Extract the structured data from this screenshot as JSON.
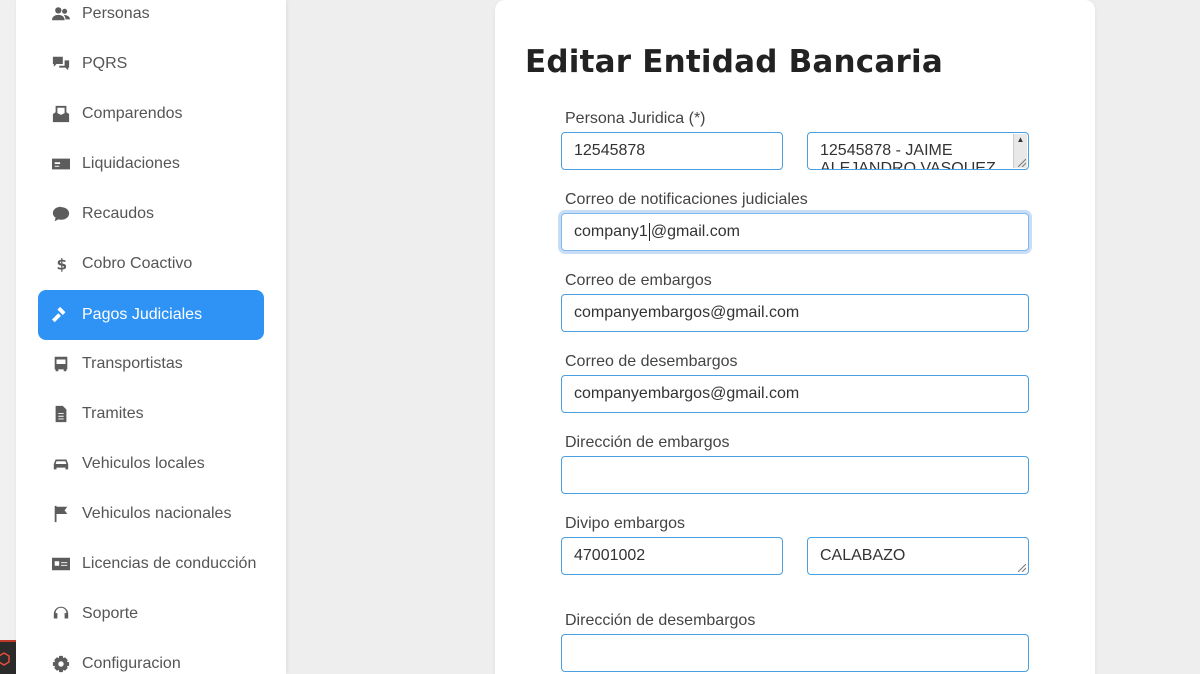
{
  "sidebar": {
    "items": [
      {
        "label": "Personas",
        "icon": "users-icon"
      },
      {
        "label": "PQRS",
        "icon": "chat-icon"
      },
      {
        "label": "Comparendos",
        "icon": "inbox-icon"
      },
      {
        "label": "Liquidaciones",
        "icon": "money-bill-icon"
      },
      {
        "label": "Recaudos",
        "icon": "comment-dollar-icon"
      },
      {
        "label": "Cobro Coactivo",
        "icon": "dollar-icon"
      },
      {
        "label": "Pagos Judiciales",
        "icon": "gavel-icon",
        "active": true
      },
      {
        "label": "Transportistas",
        "icon": "bus-icon"
      },
      {
        "label": "Tramites",
        "icon": "file-icon"
      },
      {
        "label": "Vehiculos locales",
        "icon": "car-icon"
      },
      {
        "label": "Vehiculos nacionales",
        "icon": "flag-icon"
      },
      {
        "label": "Licencias de conducción",
        "icon": "id-card-icon"
      },
      {
        "label": "Soporte",
        "icon": "headset-icon"
      },
      {
        "label": "Configuracion",
        "icon": "gear-icon"
      }
    ]
  },
  "form": {
    "title": "Editar Entidad Bancaria",
    "persona_juridica": {
      "label": "Persona Juridica (*)",
      "id_value": "12545878",
      "name_value_line1": "12545878 - JAIME",
      "name_value_line2": "ALEJANDRO VASQUEZ"
    },
    "correo_notificaciones": {
      "label": "Correo de notificaciones judiciales",
      "value_before_cursor": "company1",
      "value_after_cursor": "@gmail.com"
    },
    "correo_embargos": {
      "label": "Correo de embargos",
      "value": "companyembargos@gmail.com"
    },
    "correo_desembargos": {
      "label": "Correo de desembargos",
      "value": "companyembargos@gmail.com"
    },
    "direccion_embargos": {
      "label": "Dirección de embargos",
      "value": ""
    },
    "divipo_embargos": {
      "label": "Divipo embargos",
      "code_value": "47001002",
      "name_value": "CALABAZO"
    },
    "direccion_desembargos": {
      "label": "Dirección de desembargos",
      "value": ""
    }
  },
  "colors": {
    "accent": "#2e93f5",
    "input_border": "#4a9fe0",
    "background": "#eeeeee"
  }
}
